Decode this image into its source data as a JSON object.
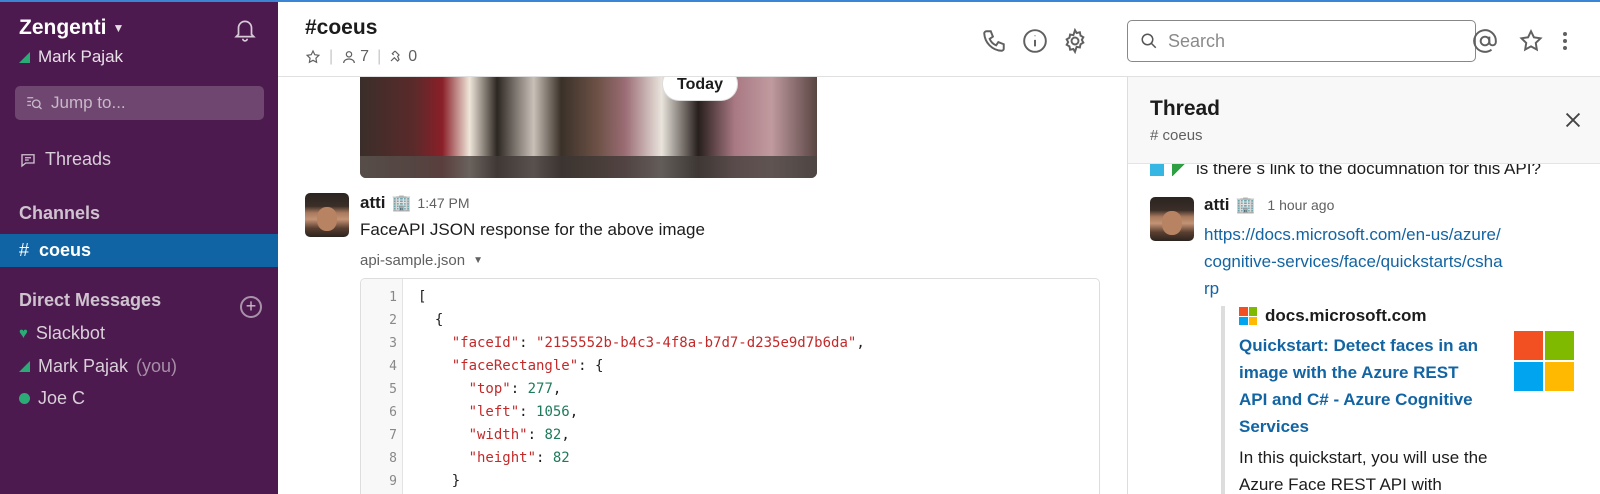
{
  "sidebar": {
    "team_name": "Zengenti",
    "user_name": "Mark Pajak",
    "jump_placeholder": "Jump to...",
    "threads_label": "Threads",
    "channels_heading": "Channels",
    "active_channel": "coeus",
    "dm_heading": "Direct Messages",
    "dms": [
      {
        "name": "Slackbot",
        "suffix": ""
      },
      {
        "name": "Mark Pajak",
        "suffix": "(you)"
      },
      {
        "name": "Joe C",
        "suffix": ""
      }
    ]
  },
  "header": {
    "channel_title": "#coeus",
    "members_count": "7",
    "pins_count": "0",
    "search_placeholder": "Search"
  },
  "messages": {
    "date_divider": "Today",
    "author": "atti",
    "time": "1:47 PM",
    "text": "FaceAPI JSON response for the above image",
    "file_name": "api-sample.json",
    "code_lines": [
      {
        "n": "1",
        "parts": [
          {
            "t": "[",
            "c": ""
          }
        ]
      },
      {
        "n": "2",
        "parts": [
          {
            "t": "  {",
            "c": ""
          }
        ]
      },
      {
        "n": "3",
        "parts": [
          {
            "t": "    ",
            "c": ""
          },
          {
            "t": "\"faceId\"",
            "c": "k"
          },
          {
            "t": ": ",
            "c": ""
          },
          {
            "t": "\"2155552b-b4c3-4f8a-b7d7-d235e9d7b6da\"",
            "c": "s"
          },
          {
            "t": ",",
            "c": ""
          }
        ]
      },
      {
        "n": "4",
        "parts": [
          {
            "t": "    ",
            "c": ""
          },
          {
            "t": "\"faceRectangle\"",
            "c": "k"
          },
          {
            "t": ": {",
            "c": ""
          }
        ]
      },
      {
        "n": "5",
        "parts": [
          {
            "t": "      ",
            "c": ""
          },
          {
            "t": "\"top\"",
            "c": "k"
          },
          {
            "t": ": ",
            "c": ""
          },
          {
            "t": "277",
            "c": "n"
          },
          {
            "t": ",",
            "c": ""
          }
        ]
      },
      {
        "n": "6",
        "parts": [
          {
            "t": "      ",
            "c": ""
          },
          {
            "t": "\"left\"",
            "c": "k"
          },
          {
            "t": ": ",
            "c": ""
          },
          {
            "t": "1056",
            "c": "n"
          },
          {
            "t": ",",
            "c": ""
          }
        ]
      },
      {
        "n": "7",
        "parts": [
          {
            "t": "      ",
            "c": ""
          },
          {
            "t": "\"width\"",
            "c": "k"
          },
          {
            "t": ": ",
            "c": ""
          },
          {
            "t": "82",
            "c": "n"
          },
          {
            "t": ",",
            "c": ""
          }
        ]
      },
      {
        "n": "8",
        "parts": [
          {
            "t": "      ",
            "c": ""
          },
          {
            "t": "\"height\"",
            "c": "k"
          },
          {
            "t": ": ",
            "c": ""
          },
          {
            "t": "82",
            "c": "n"
          }
        ]
      },
      {
        "n": "9",
        "parts": [
          {
            "t": "    }",
            "c": ""
          }
        ]
      }
    ]
  },
  "thread": {
    "title": "Thread",
    "channel": "# coeus",
    "previous_text": "is there s link to the documnation for this API?",
    "author": "atti",
    "time": "1 hour ago",
    "link": "https://docs.microsoft.com/en-us/azure/cognitive-services/face/quickstarts/csharp",
    "unfurl_site": "docs.microsoft.com",
    "unfurl_title": "Quickstart: Detect faces in an image with the Azure REST API and C# - Azure Cognitive Services",
    "unfurl_desc": "In this quickstart, you will use the Azure Face REST API with"
  },
  "colors": {
    "sidebar_bg": "#4d1a4f",
    "active_channel_bg": "#1164a3",
    "presence_green": "#2bac76",
    "link_blue": "#1264a3"
  },
  "icons": [
    "bell-icon",
    "chevron-down-icon",
    "search-icon",
    "threads-icon",
    "add-circle-icon",
    "phone-icon",
    "info-icon",
    "gear-icon",
    "at-icon",
    "star-icon",
    "more-icon",
    "person-icon",
    "pin-icon",
    "close-icon",
    "microsoft-logo"
  ]
}
